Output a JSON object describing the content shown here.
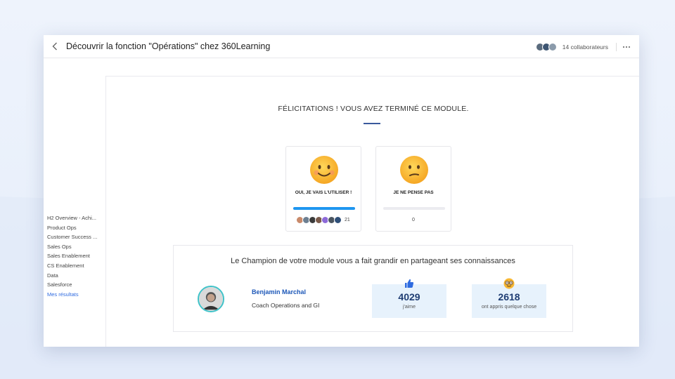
{
  "header": {
    "back_icon": "chevron-left-icon",
    "title": "Découvrir la fonction \"Opérations\" chez 360Learning",
    "collaborators_label": "14 collaborateurs",
    "more_icon": "more-horizontal-icon"
  },
  "sidebar": {
    "items": [
      {
        "label": "H2 Overview - Achi..."
      },
      {
        "label": "Product Ops"
      },
      {
        "label": "Customer Success ..."
      },
      {
        "label": "Sales Ops"
      },
      {
        "label": "Sales Enablement"
      },
      {
        "label": "CS Enablement"
      },
      {
        "label": "Data"
      },
      {
        "label": "Salesforce"
      },
      {
        "label": "Mes résultats"
      }
    ]
  },
  "main": {
    "congrats_title": "FÉLICITATIONS ! VOUS AVEZ TERMINÉ CE MODULE.",
    "options": [
      {
        "label": "OUI, JE VAIS L'UTILISER !",
        "emoji": "smiling-face-icon",
        "count": "21",
        "share": 1.0
      },
      {
        "label": "JE NE PENSE PAS",
        "emoji": "confused-face-icon",
        "count": "0",
        "share": 0.0
      }
    ],
    "champion": {
      "heading": "Le Champion de votre module vous a fait grandir en partageant ses connaissances",
      "name": "Benjamin Marchal",
      "role": "Coach Operations and GI",
      "stats": [
        {
          "icon": "thumbs-up-icon",
          "value": "4029",
          "label": "j'aime"
        },
        {
          "icon": "nerd-face-icon",
          "value": "2618",
          "label": "ont appris quelque chose"
        }
      ]
    }
  },
  "colors": {
    "accent": "#1e96f0",
    "link": "#2f6be0",
    "stat_bg": "#e7f2fc"
  }
}
